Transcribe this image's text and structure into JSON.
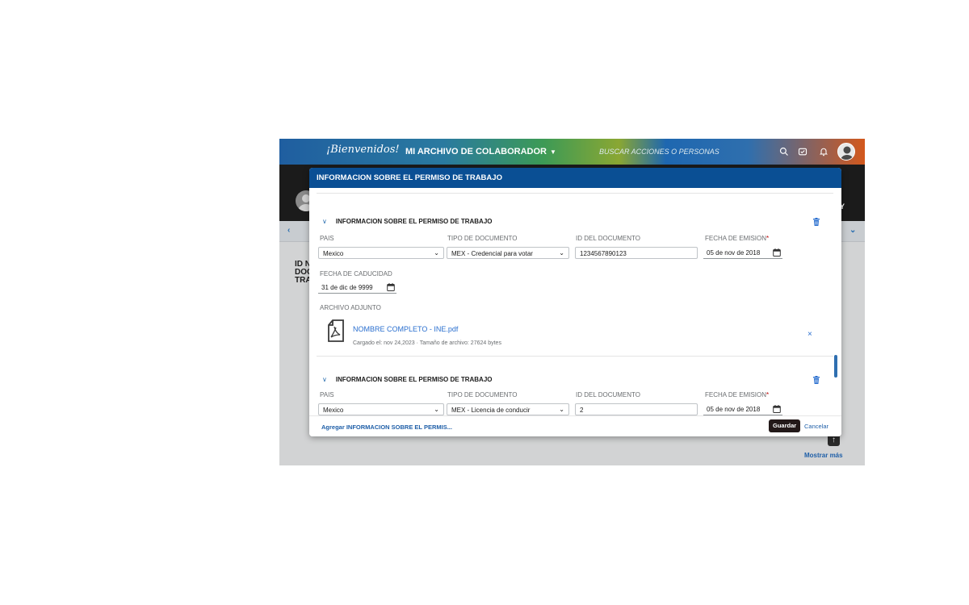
{
  "app": {
    "logo_text": "¡Bienvenidos!",
    "nav_title": "MI ARCHIVO DE COLABORADOR",
    "search_placeholder": "BUSCAR ACCIONES O PERSONAS",
    "header_letter": "Y",
    "section_title_lines": [
      "ID N",
      "DOC",
      "TRA"
    ],
    "show_more": "Mostrar más"
  },
  "dialog": {
    "title": "INFORMACION SOBRE EL PERMISO DE TRABAJO",
    "groups": [
      {
        "title": "INFORMACION SOBRE EL PERMISO DE TRABAJO",
        "country_label": "PAIS",
        "country": "Mexico",
        "doc_type_label": "TIPO DE DOCUMENTO",
        "doc_type": "MEX - Credencial para votar",
        "doc_id_label": "ID DEL DOCUMENTO",
        "doc_id": "1234567890123",
        "issue_date_label": "FECHA DE EMISION",
        "issue_date": "05 de nov de 2018",
        "expiry_date_label": "FECHA DE CADUCIDAD",
        "expiry_date": "31 de dic de 9999",
        "attachment_label": "ARCHIVO ADJUNTO",
        "attachment_name": "NOMBRE COMPLETO - INE.pdf",
        "attachment_meta": "Cargado el: nov 24,2023 · Tamaño de archivo: 27624 bytes",
        "remove_symbol": "×"
      },
      {
        "title": "INFORMACION SOBRE EL PERMISO DE TRABAJO",
        "country_label": "PAIS",
        "country": "Mexico",
        "doc_type_label": "TIPO DE DOCUMENTO",
        "doc_type": "MEX - Licencia de conducir",
        "doc_id_label": "ID DEL DOCUMENTO",
        "doc_id": "2",
        "issue_date_label": "FECHA DE EMISION",
        "issue_date": "05 de nov de 2018"
      }
    ],
    "add_link": "Agregar INFORMACION SOBRE EL PERMIS...",
    "save_label": "Guardar",
    "cancel_label": "Cancelar"
  },
  "icons": {
    "shellbar": [
      "search-icon",
      "task-icon",
      "bell-icon",
      "user-avatar"
    ],
    "group": [
      "chevron-down-icon",
      "trash-icon"
    ],
    "fields": [
      "dropdown-arrow-icon",
      "calendar-icon"
    ],
    "attachment": [
      "pdf-file-icon",
      "close-icon"
    ]
  },
  "colors": {
    "dialog_header": "#0a4f94",
    "link": "#2a6fcf",
    "required": "#bb0000",
    "save_button": "#231919",
    "profile_header": "#1b1b1b"
  }
}
